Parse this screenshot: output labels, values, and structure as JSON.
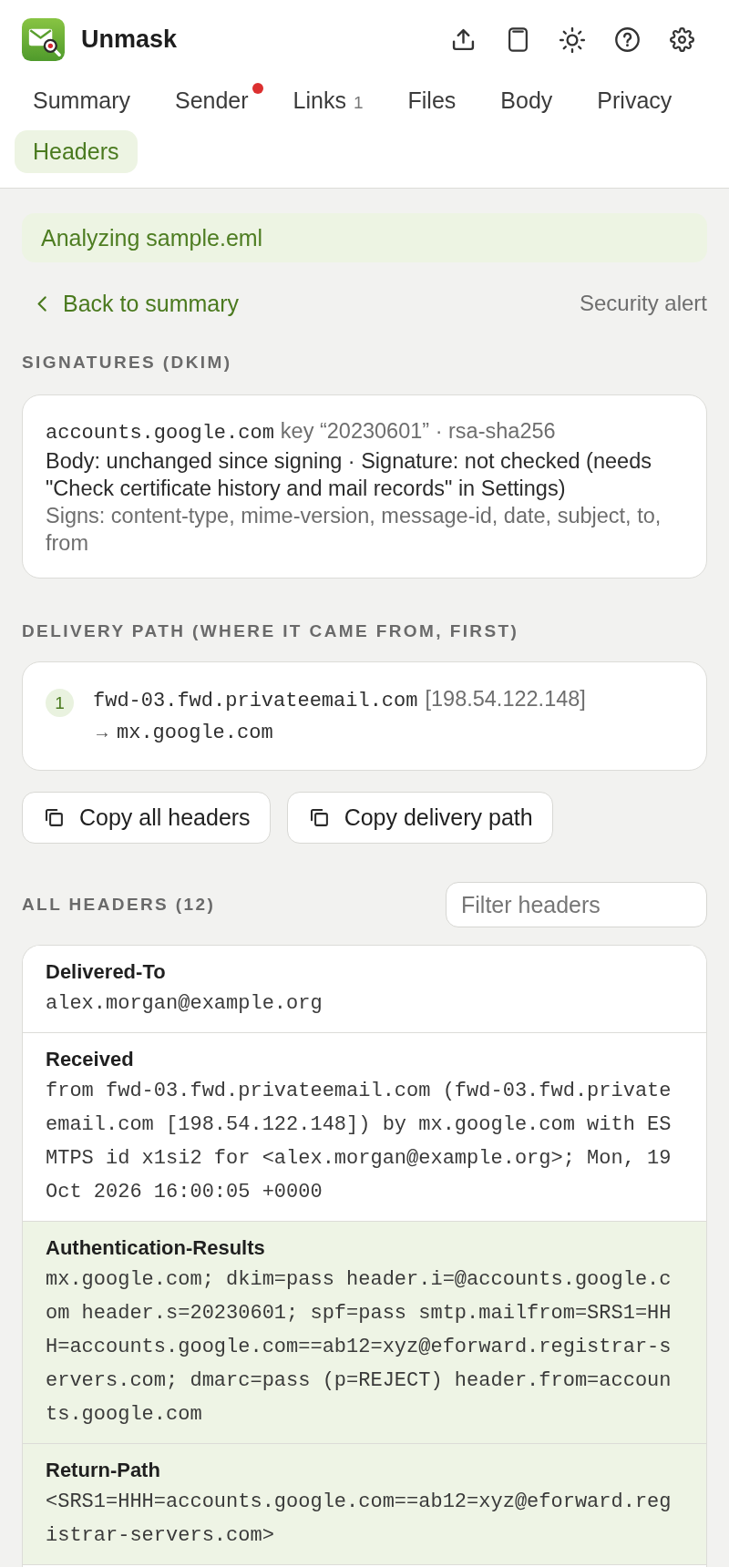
{
  "app": {
    "title": "Unmask"
  },
  "tabs": [
    {
      "label": "Summary",
      "selected": false,
      "alert": false
    },
    {
      "label": "Sender",
      "selected": false,
      "alert": true
    },
    {
      "label": "Links",
      "count": "1",
      "selected": false,
      "alert": false
    },
    {
      "label": "Files",
      "selected": false,
      "alert": false
    },
    {
      "label": "Body",
      "selected": false,
      "alert": false
    },
    {
      "label": "Privacy",
      "selected": false,
      "alert": false
    },
    {
      "label": "Headers",
      "selected": true,
      "alert": false
    }
  ],
  "banner": {
    "text": "Analyzing sample.eml"
  },
  "nav": {
    "back_link": "Back to summary",
    "context": "Security alert"
  },
  "signatures": {
    "heading": "SIGNATURES (DKIM)",
    "items": [
      {
        "domain": "accounts.google.com",
        "details": "key “20230601” · rsa-sha256",
        "status": "Body: unchanged since signing · Signature: not checked (needs \"Check certificate history and mail records\" in Settings)",
        "signed_headers": "Signs: content-type, mime-version, message-id, date, subject, to, from"
      }
    ]
  },
  "delivery_path": {
    "heading": "DELIVERY PATH (WHERE IT CAME FROM, FIRST)",
    "hops": [
      {
        "step": "1",
        "from_host": "fwd-03.fwd.privateemail.com",
        "from_ip": "[198.54.122.148]",
        "arrow": "→",
        "to_host": "mx.google.com"
      }
    ]
  },
  "actions": [
    {
      "label": "Copy all headers"
    },
    {
      "label": "Copy delivery path"
    }
  ],
  "headers": {
    "heading": "ALL HEADERS (12)",
    "filter": {
      "placeholder": "Filter headers"
    },
    "rows": [
      {
        "name": "Delivered-To",
        "value": "alex.morgan@example.org",
        "highlighted": false
      },
      {
        "name": "Received",
        "value": "from fwd-03.fwd.privateemail.com (fwd-03.fwd.privateemail.com [198.54.122.148]) by mx.google.com with ESMTPS id x1si2 for <alex.morgan@example.org>; Mon, 19 Oct 2026 16:00:05 +0000",
        "highlighted": false
      },
      {
        "name": "Authentication-Results",
        "value": "mx.google.com; dkim=pass header.i=@accounts.google.com header.s=20230601; spf=pass smtp.mailfrom=SRS1=HHH=accounts.google.com==ab12=xyz@eforward.registrar-servers.com; dmarc=pass (p=REJECT) header.from=accounts.google.com",
        "highlighted": true
      },
      {
        "name": "Return-Path",
        "value": "<SRS1=HHH=accounts.google.com==ab12=xyz@eforward.registrar-servers.com>",
        "highlighted": true
      }
    ]
  }
}
